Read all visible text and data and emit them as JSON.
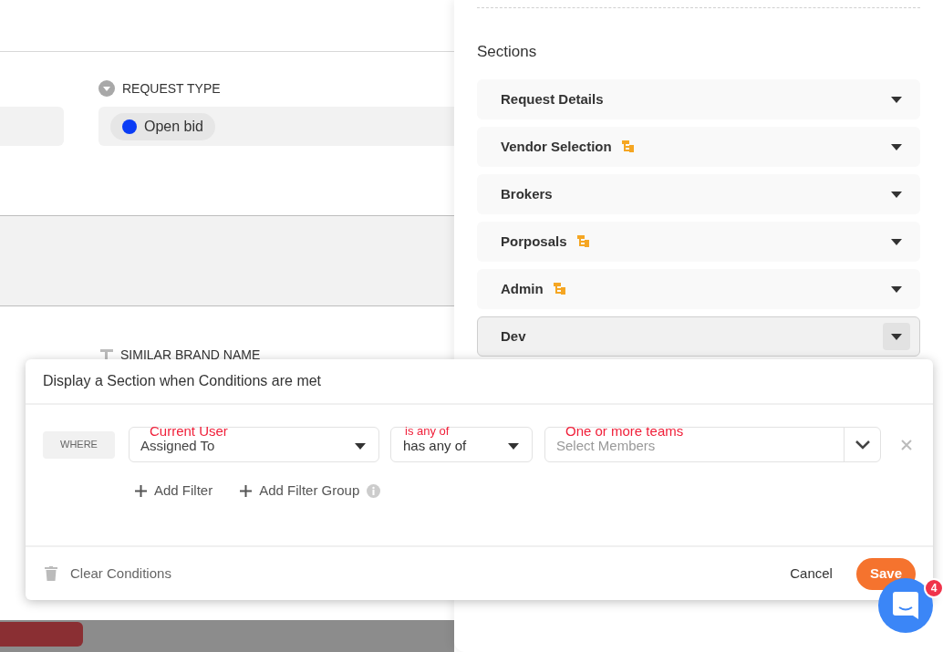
{
  "left_form": {
    "request_type": {
      "label": "REQUEST TYPE",
      "value": "Open bid",
      "color": "#0a3cf5"
    },
    "similar_brand_name": {
      "label": "SIMILAR BRAND NAME"
    }
  },
  "sections_panel": {
    "title": "Sections",
    "items": [
      {
        "label": "Request Details",
        "conditional": false,
        "selected": false
      },
      {
        "label": "Vendor Selection",
        "conditional": true,
        "selected": false
      },
      {
        "label": "Brokers",
        "conditional": false,
        "selected": false
      },
      {
        "label": "Porposals",
        "conditional": true,
        "selected": false
      },
      {
        "label": "Admin",
        "conditional": true,
        "selected": false
      },
      {
        "label": "Dev",
        "conditional": false,
        "selected": true
      }
    ]
  },
  "dialog": {
    "title": "Display a Section when Conditions are met",
    "where": "WHERE",
    "field": {
      "value": "Assigned To",
      "annotation": "Current User"
    },
    "operator": {
      "value": "has any of",
      "annotation": "is any of"
    },
    "members": {
      "placeholder": "Select Members",
      "annotation": "One or more teams"
    },
    "add_filter": "Add Filter",
    "add_filter_group": "Add Filter Group",
    "clear": "Clear Conditions",
    "cancel": "Cancel",
    "save": "Save"
  },
  "chat": {
    "badge": "4"
  }
}
